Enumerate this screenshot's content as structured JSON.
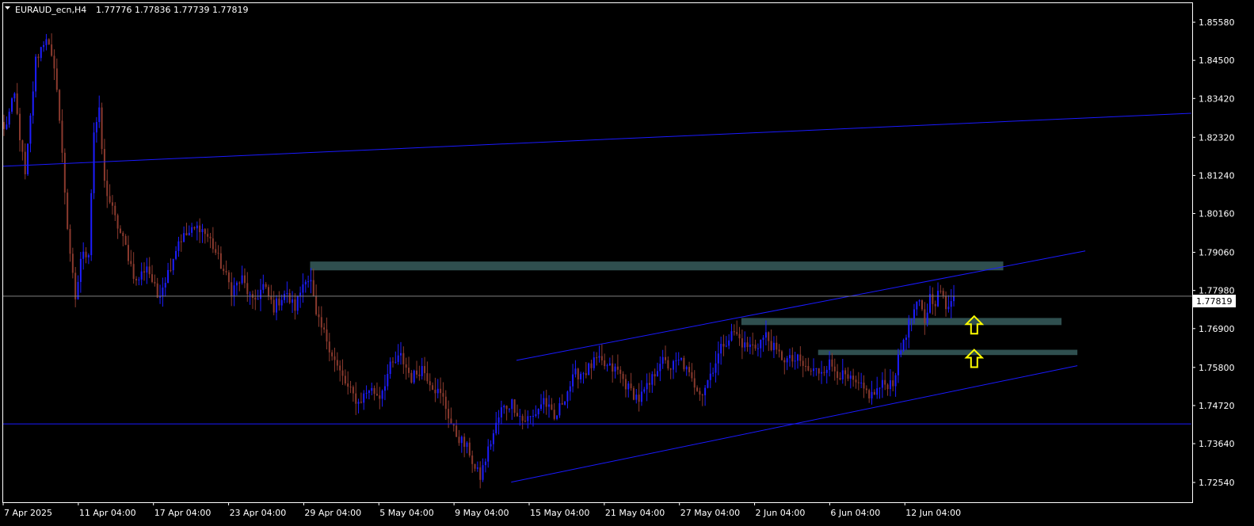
{
  "header": {
    "symbol": "EURAUD_ecn,H4",
    "ohlc": "1.77776 1.77836 1.77739 1.77819"
  },
  "colors": {
    "background": "#000000",
    "frame": "#ffffff",
    "bull": "#1d1dff",
    "bear": "#8b3a2e",
    "trendline": "#1a1aff",
    "zone": "#2f4f4f",
    "price_line": "#808080",
    "arrow": "#ffff00",
    "text": "#ffffff"
  },
  "chart_data": {
    "type": "candlestick",
    "ylim": [
      1.7198,
      1.8612
    ],
    "y_ticks": [
      "1.85580",
      "1.84500",
      "1.83420",
      "1.82320",
      "1.81240",
      "1.80160",
      "1.79060",
      "1.77980",
      "1.76900",
      "1.75800",
      "1.74720",
      "1.73640",
      "1.72540"
    ],
    "x_ticks": [
      "7 Apr 2025",
      "11 Apr 04:00",
      "17 Apr 04:00",
      "23 Apr 04:00",
      "29 Apr 04:00",
      "5 May 04:00",
      "9 May 04:00",
      "15 May 04:00",
      "21 May 04:00",
      "27 May 04:00",
      "2 Jun 04:00",
      "6 Jun 04:00",
      "12 Jun 04:00"
    ],
    "current_price": "1.77819",
    "waypoints": [
      [
        0,
        1.825
      ],
      [
        4,
        1.835
      ],
      [
        8,
        1.812
      ],
      [
        12,
        1.845
      ],
      [
        16,
        1.852
      ],
      [
        20,
        1.838
      ],
      [
        24,
        1.798
      ],
      [
        27,
        1.776
      ],
      [
        29,
        1.789
      ],
      [
        32,
        1.791
      ],
      [
        34,
        1.825
      ],
      [
        36,
        1.83
      ],
      [
        38,
        1.81
      ],
      [
        42,
        1.8
      ],
      [
        46,
        1.792
      ],
      [
        50,
        1.782
      ],
      [
        54,
        1.787
      ],
      [
        58,
        1.778
      ],
      [
        62,
        1.785
      ],
      [
        66,
        1.794
      ],
      [
        70,
        1.796
      ],
      [
        74,
        1.798
      ],
      [
        78,
        1.794
      ],
      [
        82,
        1.787
      ],
      [
        86,
        1.78
      ],
      [
        90,
        1.783
      ],
      [
        94,
        1.776
      ],
      [
        98,
        1.781
      ],
      [
        102,
        1.775
      ],
      [
        106,
        1.779
      ],
      [
        110,
        1.775
      ],
      [
        114,
        1.784
      ],
      [
        116,
        1.782
      ],
      [
        118,
        1.772
      ],
      [
        122,
        1.766
      ],
      [
        126,
        1.758
      ],
      [
        130,
        1.752
      ],
      [
        134,
        1.748
      ],
      [
        138,
        1.752
      ],
      [
        142,
        1.75
      ],
      [
        146,
        1.758
      ],
      [
        150,
        1.761
      ],
      [
        154,
        1.755
      ],
      [
        158,
        1.758
      ],
      [
        162,
        1.753
      ],
      [
        166,
        1.749
      ],
      [
        170,
        1.74
      ],
      [
        174,
        1.736
      ],
      [
        176,
        1.734
      ],
      [
        178,
        1.729
      ],
      [
        180,
        1.727
      ],
      [
        184,
        1.737
      ],
      [
        188,
        1.746
      ],
      [
        192,
        1.748
      ],
      [
        196,
        1.743
      ],
      [
        200,
        1.744
      ],
      [
        204,
        1.749
      ],
      [
        208,
        1.743
      ],
      [
        212,
        1.75
      ],
      [
        216,
        1.756
      ],
      [
        220,
        1.757
      ],
      [
        224,
        1.76
      ],
      [
        228,
        1.758
      ],
      [
        232,
        1.757
      ],
      [
        236,
        1.752
      ],
      [
        240,
        1.749
      ],
      [
        244,
        1.753
      ],
      [
        248,
        1.76
      ],
      [
        252,
        1.758
      ],
      [
        256,
        1.76
      ],
      [
        260,
        1.754
      ],
      [
        264,
        1.751
      ],
      [
        268,
        1.758
      ],
      [
        272,
        1.765
      ],
      [
        276,
        1.768
      ],
      [
        280,
        1.764
      ],
      [
        284,
        1.764
      ],
      [
        288,
        1.767
      ],
      [
        292,
        1.762
      ],
      [
        296,
        1.76
      ],
      [
        300,
        1.76
      ],
      [
        304,
        1.757
      ],
      [
        308,
        1.757
      ],
      [
        312,
        1.759
      ],
      [
        316,
        1.756
      ],
      [
        320,
        1.754
      ],
      [
        324,
        1.752
      ],
      [
        328,
        1.75
      ],
      [
        332,
        1.753
      ],
      [
        336,
        1.754
      ],
      [
        340,
        1.766
      ],
      [
        344,
        1.774
      ],
      [
        346,
        1.776
      ],
      [
        348,
        1.771
      ],
      [
        350,
        1.778
      ],
      [
        352,
        1.777
      ],
      [
        354,
        1.78
      ],
      [
        356,
        1.774
      ],
      [
        358,
        1.778
      ],
      [
        359,
        1.778
      ]
    ]
  }
}
